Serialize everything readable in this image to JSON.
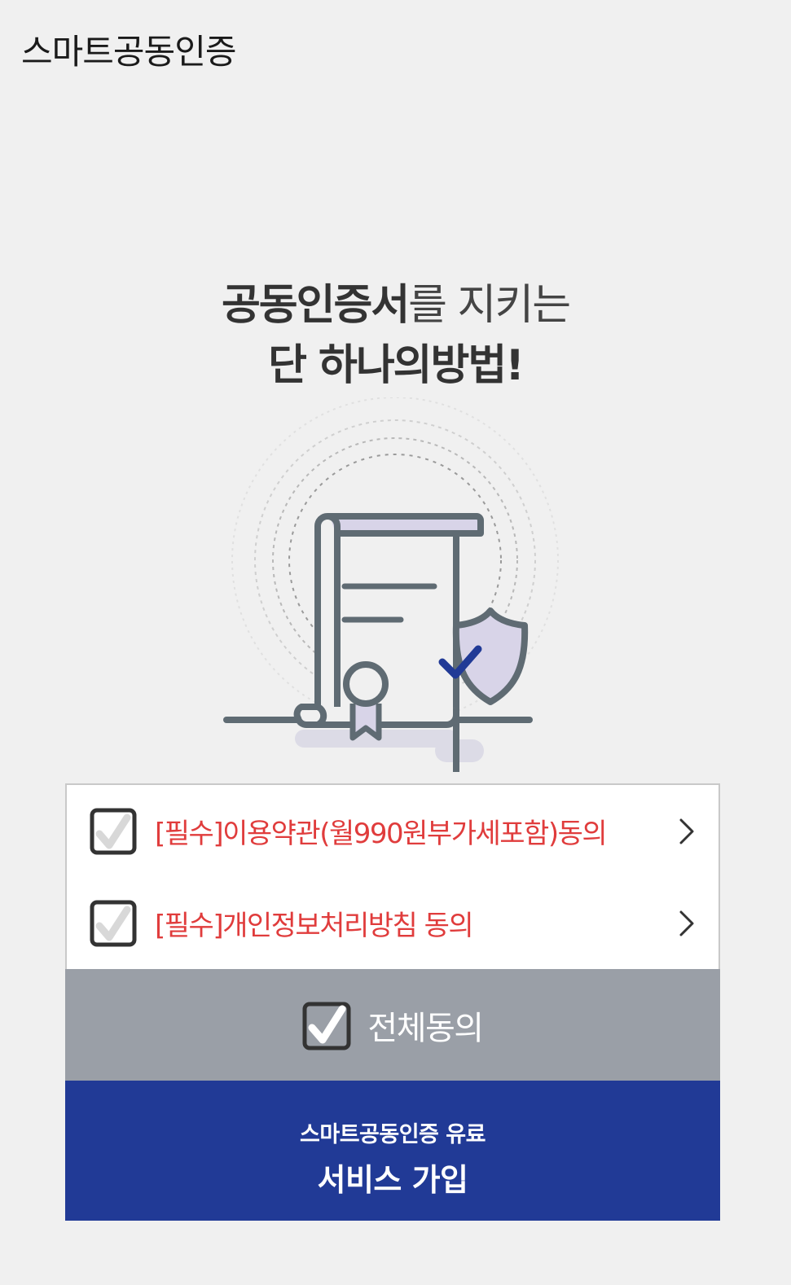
{
  "header": {
    "title": "스마트공동인증"
  },
  "headline": {
    "line1_bold": "공동인증서",
    "line1_rest": "를 지키는",
    "line2": "단 하나의방법!"
  },
  "illustration": {
    "icon": "certificate-shield-icon",
    "colors": {
      "outline": "#5f6b73",
      "fill": "#d8d4e8",
      "check": "#213a96"
    }
  },
  "terms": [
    {
      "label": "[필수]이용약관(월990원부가세포함)동의",
      "checked": true
    },
    {
      "label": "[필수]개인정보처리방침 동의",
      "checked": true
    }
  ],
  "agree_all": {
    "label": "전체동의",
    "checked": true
  },
  "signup": {
    "sub_label": "스마트공동인증 유료",
    "main_label": "서비스 가입"
  },
  "colors": {
    "required_text": "#e03c3c",
    "agree_all_bg": "#9a9fa7",
    "signup_bg": "#213a96"
  }
}
